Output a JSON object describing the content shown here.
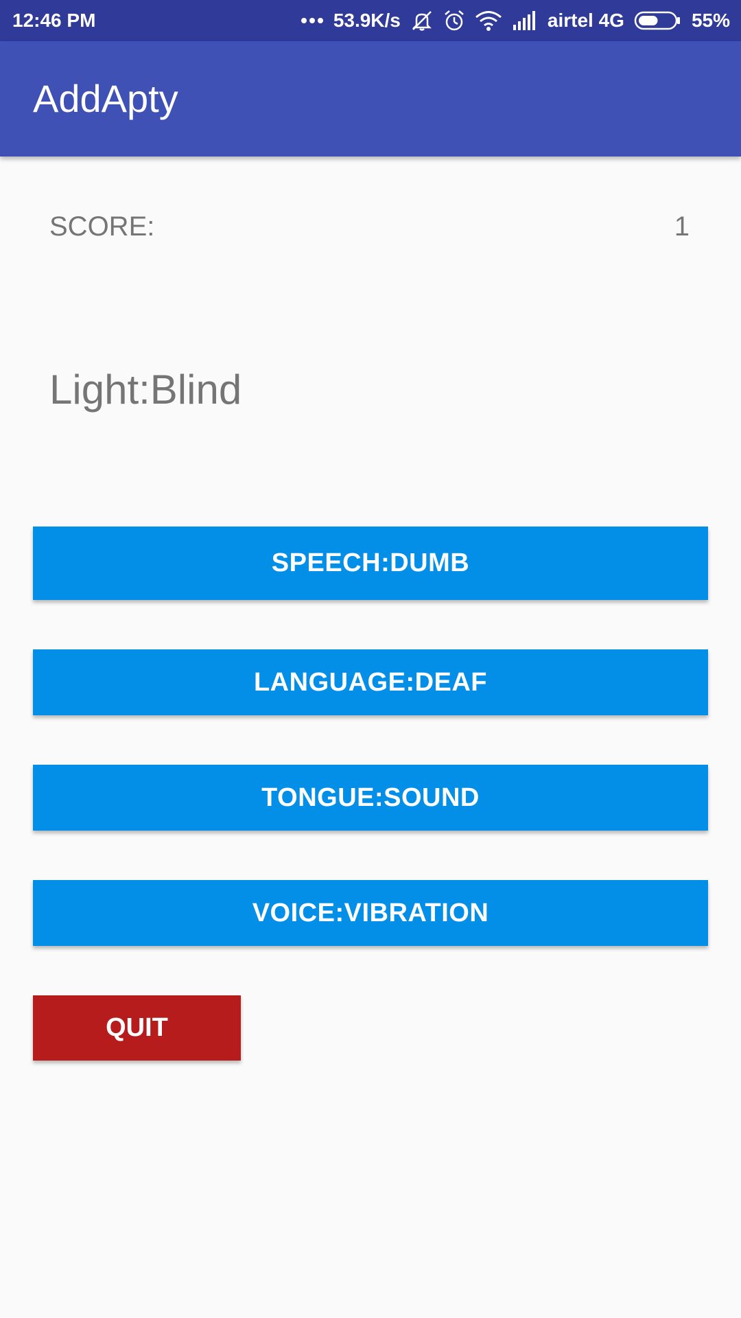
{
  "status_bar": {
    "time": "12:46 PM",
    "network_speed": "53.9K/s",
    "carrier": "airtel 4G",
    "battery": "55%",
    "icons": [
      "more-dots-icon",
      "mute-icon",
      "alarm-icon",
      "wifi-icon",
      "signal-icon",
      "battery-icon"
    ],
    "battery_level": 0.55
  },
  "app_bar": {
    "title": "AddApty"
  },
  "score": {
    "label": "SCORE:",
    "value": "1"
  },
  "question": {
    "text": "Light:Blind"
  },
  "answers": [
    {
      "label": "SPEECH:DUMB"
    },
    {
      "label": "LANGUAGE:DEAF"
    },
    {
      "label": "TONGUE:SOUND"
    },
    {
      "label": "VOICE:VIBRATION"
    }
  ],
  "quit": {
    "label": "QUIT"
  },
  "colors": {
    "status_bar": "#2f3a99",
    "app_bar": "#3f51b5",
    "answer_button": "#038fe8",
    "quit_button": "#b71c1c",
    "background": "#fafafa",
    "secondary_text": "#757575"
  }
}
